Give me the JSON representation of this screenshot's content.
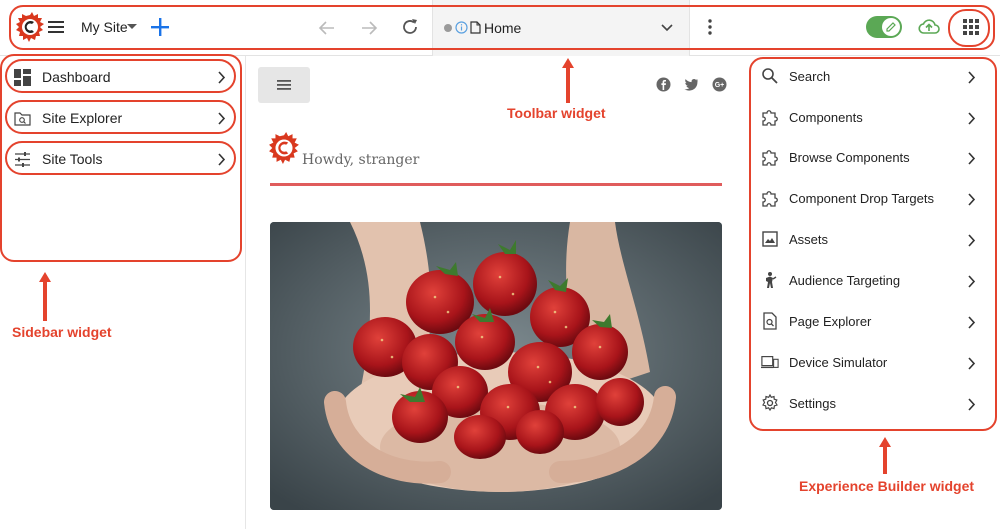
{
  "toolbar": {
    "site_name": "My Site",
    "address_text": "Home"
  },
  "sidebar": {
    "items": [
      {
        "label": "Dashboard",
        "icon": "dashboard-icon"
      },
      {
        "label": "Site Explorer",
        "icon": "folder-search-icon"
      },
      {
        "label": "Site Tools",
        "icon": "sliders-icon"
      }
    ]
  },
  "main": {
    "greeting": "Howdy, stranger",
    "social": [
      "facebook-icon",
      "twitter-icon",
      "google-plus-icon"
    ],
    "hero_image": "strawberries-in-hands"
  },
  "right_panel": {
    "items": [
      {
        "label": "Search",
        "icon": "search-icon"
      },
      {
        "label": "Components",
        "icon": "puzzle-icon"
      },
      {
        "label": "Browse Components",
        "icon": "puzzle-icon"
      },
      {
        "label": "Component Drop Targets",
        "icon": "puzzle-icon"
      },
      {
        "label": "Assets",
        "icon": "image-icon"
      },
      {
        "label": "Audience Targeting",
        "icon": "person-icon"
      },
      {
        "label": "Page Explorer",
        "icon": "page-search-icon"
      },
      {
        "label": "Device Simulator",
        "icon": "devices-icon"
      },
      {
        "label": "Settings",
        "icon": "gear-icon"
      }
    ]
  },
  "annotations": {
    "toolbar": "Toolbar widget",
    "sidebar": "Sidebar widget",
    "experience_builder": "Experience Builder widget"
  },
  "colors": {
    "accent": "#e4432d",
    "toggle": "#5ba855",
    "plus": "#1a73e8",
    "cloud": "#5ba855"
  }
}
